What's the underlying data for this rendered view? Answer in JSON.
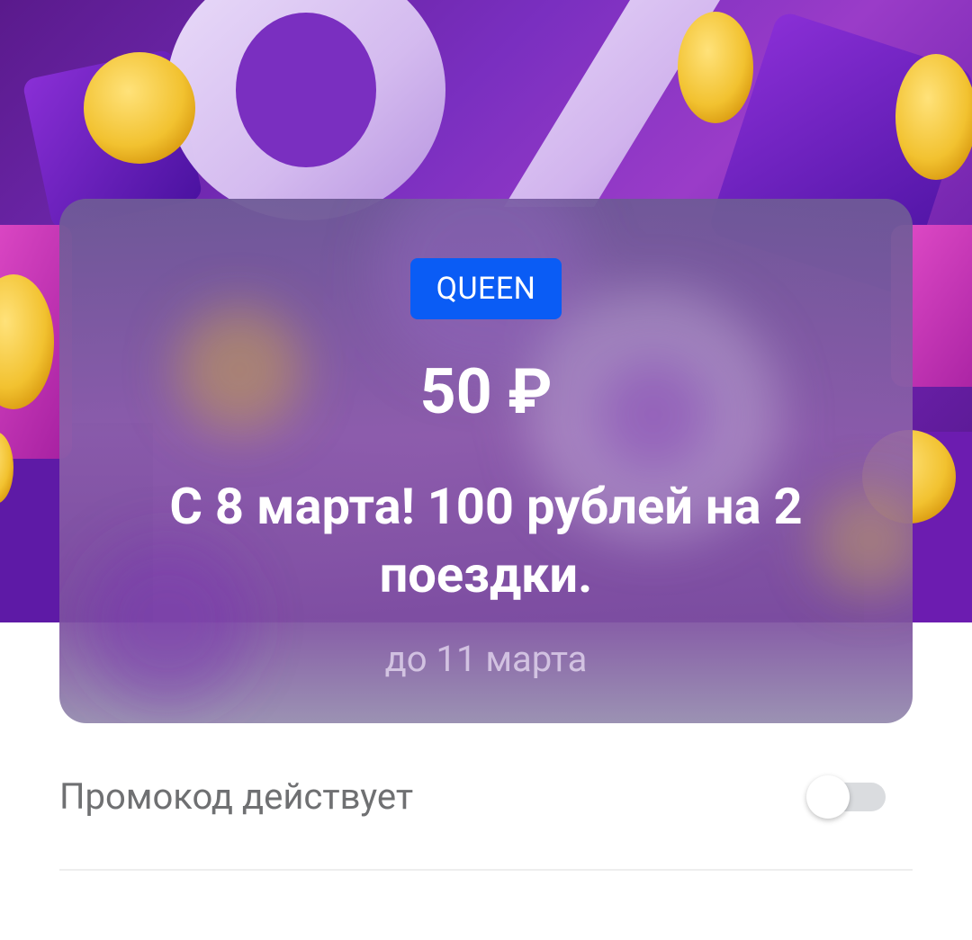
{
  "promo": {
    "code": "QUEEN",
    "amount": "50 ₽",
    "title": "С 8 марта! 100 рублей на 2 поездки.",
    "valid_until": "до 11 марта"
  },
  "status": {
    "label": "Промокод действует",
    "toggle_on": false
  },
  "colors": {
    "badge": "#0a5cf5",
    "hero_purple": "#7a2fc0",
    "coin_yellow": "#f2c230",
    "label_gray": "#6f7072"
  }
}
